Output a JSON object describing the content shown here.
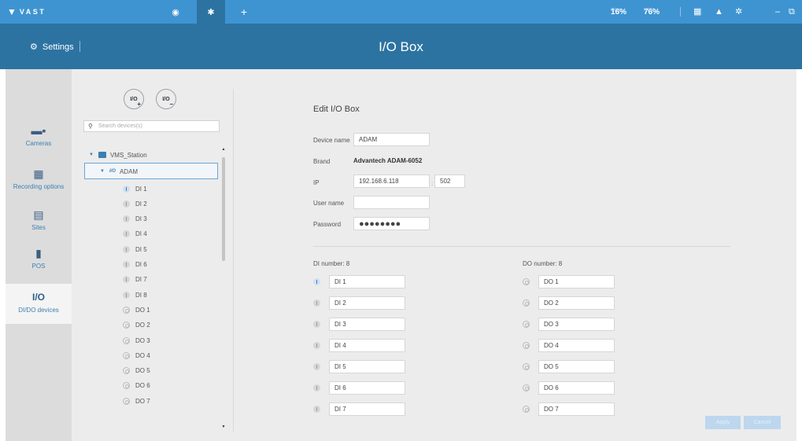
{
  "titlebar": {
    "logo": "VAST",
    "cpu_label": "CPU",
    "cpu_value": "16%",
    "mem_label": "MEM",
    "mem_value": "76%",
    "tabs": [
      {
        "name": "liveview",
        "icon": "eye-icon"
      },
      {
        "name": "settings",
        "icon": "gear-icon"
      },
      {
        "name": "add",
        "icon": "plus-icon"
      }
    ],
    "right_icons": [
      "grid-icon",
      "bell-icon",
      "settings-icon",
      "minimize-icon",
      "restore-icon"
    ]
  },
  "header": {
    "settings_label": "Settings",
    "page_title": "I/O Box"
  },
  "sidebar": {
    "items": [
      {
        "label": "Cameras",
        "icon": "camera-icon",
        "active": false
      },
      {
        "label": "Recording options",
        "icon": "calendar-icon",
        "active": false
      },
      {
        "label": "Sites",
        "icon": "server-icon",
        "active": false
      },
      {
        "label": "POS",
        "icon": "pos-icon",
        "active": false
      },
      {
        "label": "DI/DO devices",
        "icon": "io-icon",
        "icon_text": "I/O",
        "active": true
      }
    ]
  },
  "tree": {
    "add_button_text": "I/O",
    "remove_button_text": "I/O",
    "add_symbol": "+",
    "remove_symbol": "−",
    "search_placeholder": "Search devices(s)",
    "station": "VMS_Station",
    "device_tag": "I/O",
    "device": "ADAM",
    "items": [
      {
        "label": "DI 1",
        "kind": "di",
        "active": true
      },
      {
        "label": "DI 2",
        "kind": "di",
        "active": false
      },
      {
        "label": "DI 3",
        "kind": "di",
        "active": false
      },
      {
        "label": "DI 4",
        "kind": "di",
        "active": false
      },
      {
        "label": "DI 5",
        "kind": "di",
        "active": false
      },
      {
        "label": "DI 6",
        "kind": "di",
        "active": false
      },
      {
        "label": "DI 7",
        "kind": "di",
        "active": false
      },
      {
        "label": "DI 8",
        "kind": "di",
        "active": false
      },
      {
        "label": "DO 1",
        "kind": "do",
        "active": false
      },
      {
        "label": "DO 2",
        "kind": "do",
        "active": false
      },
      {
        "label": "DO 3",
        "kind": "do",
        "active": false
      },
      {
        "label": "DO 4",
        "kind": "do",
        "active": false
      },
      {
        "label": "DO 5",
        "kind": "do",
        "active": false
      },
      {
        "label": "DO 6",
        "kind": "do",
        "active": false
      },
      {
        "label": "DO 7",
        "kind": "do",
        "active": false
      }
    ]
  },
  "form": {
    "title": "Edit I/O Box",
    "device_name_label": "Device name",
    "device_name_value": "ADAM",
    "brand_label": "Brand",
    "brand_value": "Advantech  ADAM-6052",
    "ip_label": "IP",
    "ip_value": "192.168.6.118",
    "port_value": "502",
    "port_separator": ":",
    "username_label": "User name",
    "username_value": "",
    "password_label": "Password",
    "password_value": "●●●●●●●●",
    "di_number_label": "DI number: 8",
    "do_number_label": "DO number: 8",
    "di_rows": [
      "DI 1",
      "DI 2",
      "DI 3",
      "DI 4",
      "DI 5",
      "DI 6",
      "DI 7"
    ],
    "do_rows": [
      "DO 1",
      "DO 2",
      "DO 3",
      "DO 4",
      "DO 5",
      "DO 6",
      "DO 7"
    ],
    "apply_label": "Apply",
    "cancel_label": "Cancel"
  }
}
